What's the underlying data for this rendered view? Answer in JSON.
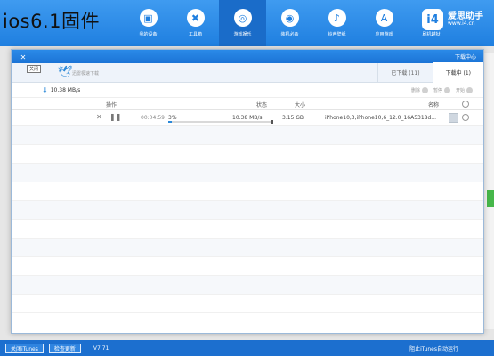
{
  "overlay_title": "ios6.1固件",
  "nav": {
    "items": [
      {
        "label": "我的设备",
        "icon": "device-icon"
      },
      {
        "label": "工具箱",
        "icon": "tools-icon"
      },
      {
        "label": "游戏娱乐",
        "icon": "game-icon",
        "active": true
      },
      {
        "label": "装机必备",
        "icon": "download-icon"
      },
      {
        "label": "铃声壁纸",
        "icon": "bell-icon"
      },
      {
        "label": "应用游戏",
        "icon": "app-icon"
      },
      {
        "label": "刷机越狱",
        "icon": "hand-icon"
      }
    ]
  },
  "brand": {
    "name": "爱思助手",
    "url": "www.i4.cn",
    "logo": "i4"
  },
  "window": {
    "title": "下载中心",
    "close_tooltip": "关闭",
    "tabs": {
      "downloading": "下载中 (1)",
      "done": "已下载 (11)"
    },
    "hint": "迅雷极速下载",
    "toolbar": {
      "speed": "10.38 MB/s",
      "start": "开始",
      "pause": "暂停",
      "delete": "删除"
    },
    "columns": {
      "name": "名称",
      "size": "大小",
      "status": "状态",
      "action": "操作"
    },
    "rows": [
      {
        "name": "iPhone10,3,iPhone10,6_12.0_16A5318d...",
        "size": "3.15 GB",
        "speed": "10.38 MB/s",
        "percent": "3%",
        "progress": 0.03,
        "time": "00:04:59"
      }
    ]
  },
  "bottom_bar": {
    "btn_close": "关闭iTunes",
    "btn_update": "检查更新",
    "version": "V7.71",
    "right": "阻止iTunes自动运行"
  }
}
